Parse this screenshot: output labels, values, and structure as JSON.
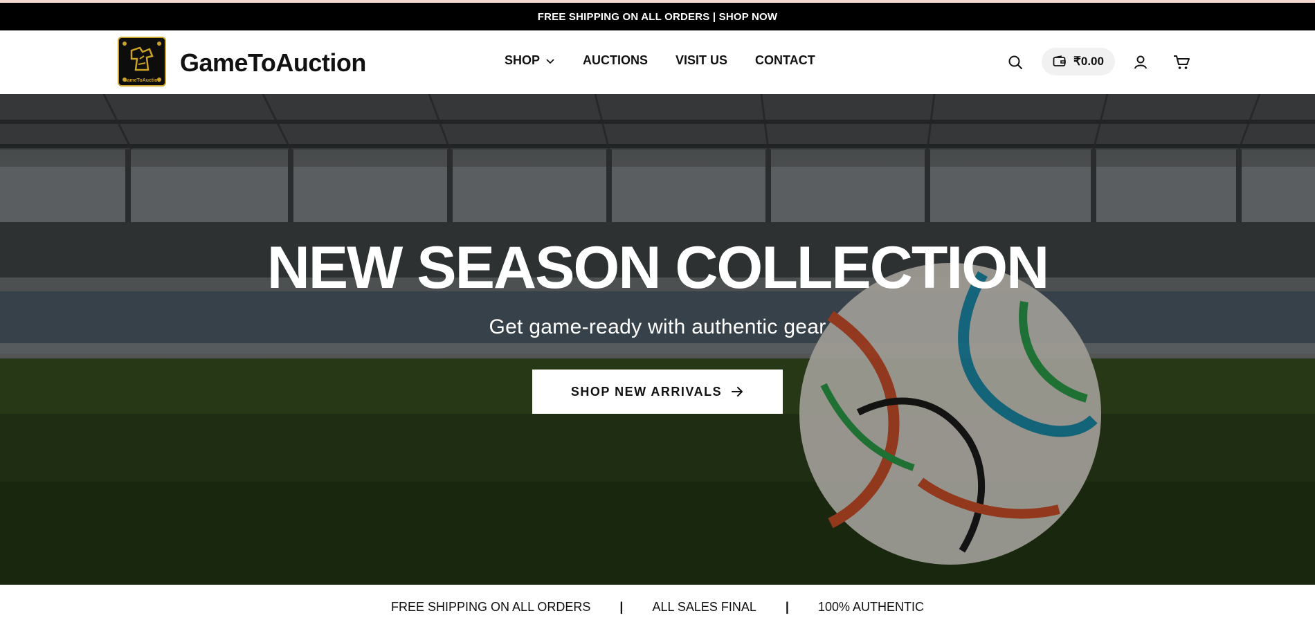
{
  "announcement": {
    "text": "FREE SHIPPING ON ALL ORDERS | SHOP NOW"
  },
  "brand": {
    "name": "GameToAuction",
    "logo_text": "GameToAuction"
  },
  "nav": {
    "items": [
      {
        "label": "SHOP",
        "has_dropdown": true,
        "icon": "chevron-down-icon"
      },
      {
        "label": "AUCTIONS"
      },
      {
        "label": "VISIT US"
      },
      {
        "label": "CONTACT"
      }
    ]
  },
  "header_actions": {
    "search_icon": "search-icon",
    "wallet_icon": "wallet-icon",
    "wallet_balance": "₹0.00",
    "account_icon": "user-icon",
    "cart_icon": "cart-icon"
  },
  "hero": {
    "title": "NEW SEASON COLLECTION",
    "subtitle": "Get game-ready with authentic gear",
    "cta_label": "SHOP NEW ARRIVALS",
    "cta_icon": "arrow-right-icon"
  },
  "features": {
    "items": [
      "FREE SHIPPING ON ALL ORDERS",
      "ALL SALES FINAL",
      "100% AUTHENTIC"
    ],
    "separator": "|"
  },
  "colors": {
    "announcement_bg": "#000000",
    "top_strip": "#f5d9d0",
    "logo_gold": "#c9a227",
    "wallet_bg": "#f1f1f1"
  }
}
